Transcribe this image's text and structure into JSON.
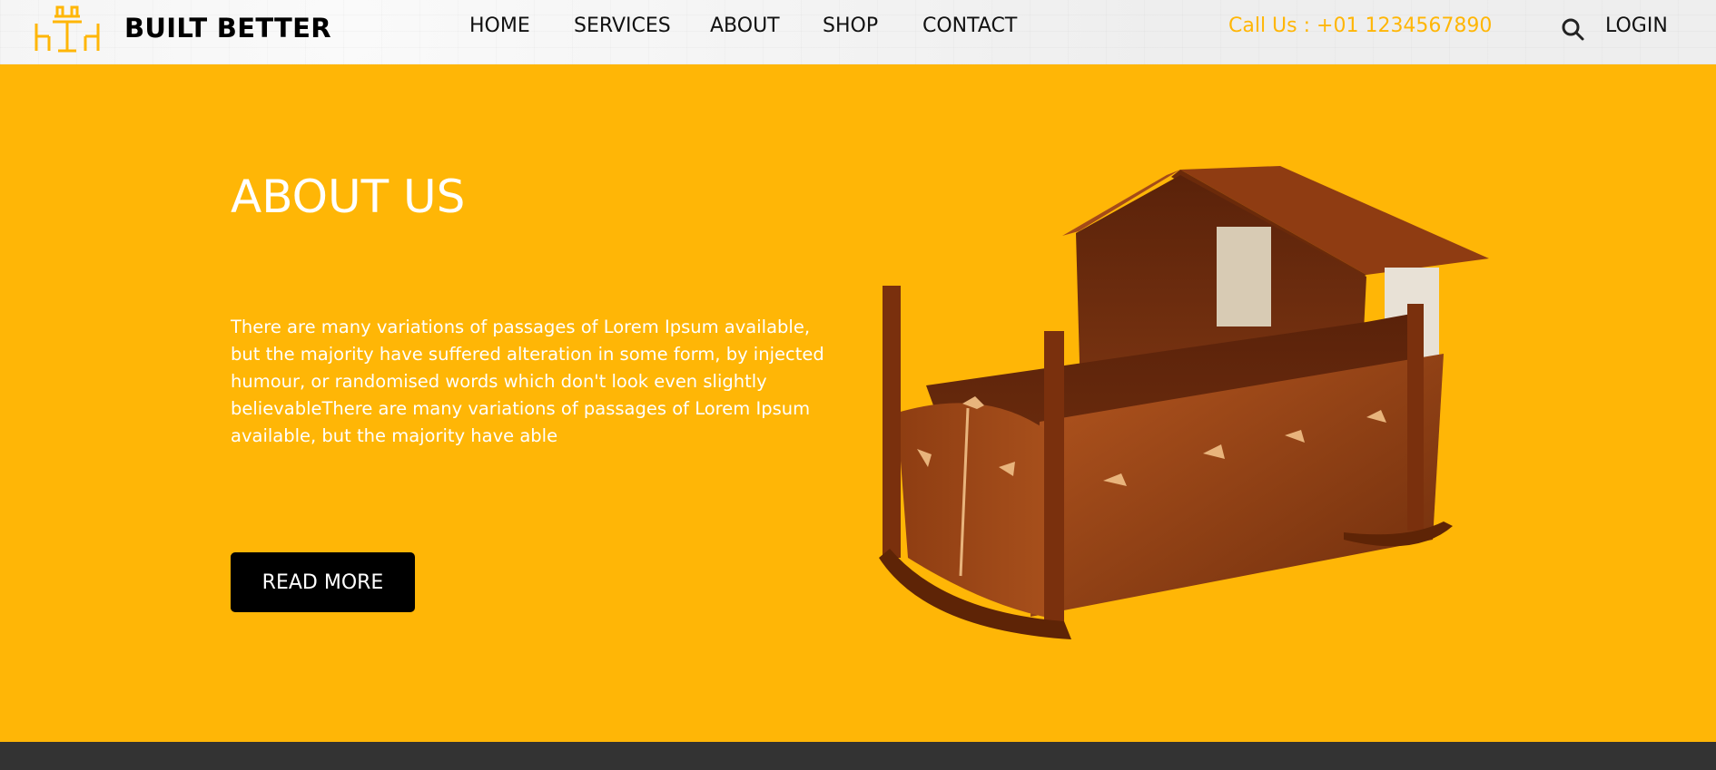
{
  "brand": {
    "name": "BUILT BETTER",
    "logo_icon": "furniture-logo-icon"
  },
  "nav": {
    "items": [
      {
        "label": "HOME"
      },
      {
        "label": "SERVICES"
      },
      {
        "label": "ABOUT"
      },
      {
        "label": "SHOP"
      },
      {
        "label": "CONTACT"
      }
    ]
  },
  "header": {
    "call_text": "Call Us : +01 1234567890",
    "search_icon": "search-icon",
    "login_label": "LOGIN"
  },
  "about": {
    "title": "ABOUT US",
    "text": "There are many variations of passages of Lorem Ipsum available, but the majority have suffered alteration in some form, by injected humour, or randomised words which don't look even slightly believableThere are many variations of passages of Lorem Ipsum available, but the majority have able",
    "button_label": "READ MORE",
    "image": "wooden-cradle-image"
  },
  "colors": {
    "accent": "#ffb606",
    "button_bg": "#000000",
    "footer": "#333333"
  }
}
